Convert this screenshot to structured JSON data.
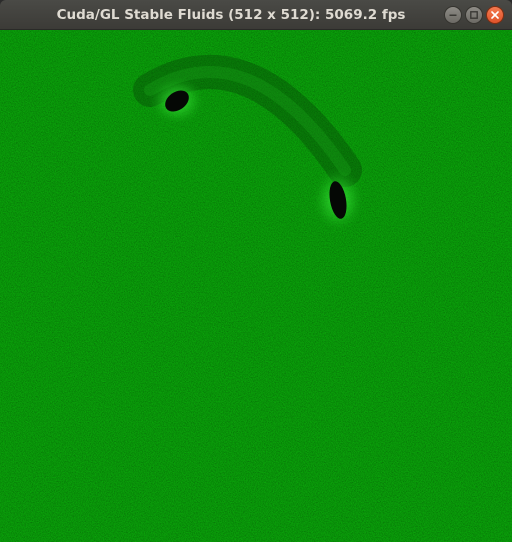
{
  "window": {
    "title": "Cuda/GL Stable Fluids (512 x 512): 5069.2 fps",
    "controls": {
      "minimize_icon": "minimize-icon",
      "maximize_icon": "maximize-icon",
      "close_icon": "close-icon"
    }
  },
  "canvas": {
    "fluid_color": "#0e9a0e",
    "highlight_color": "#38e838",
    "void_color": "#050805"
  }
}
